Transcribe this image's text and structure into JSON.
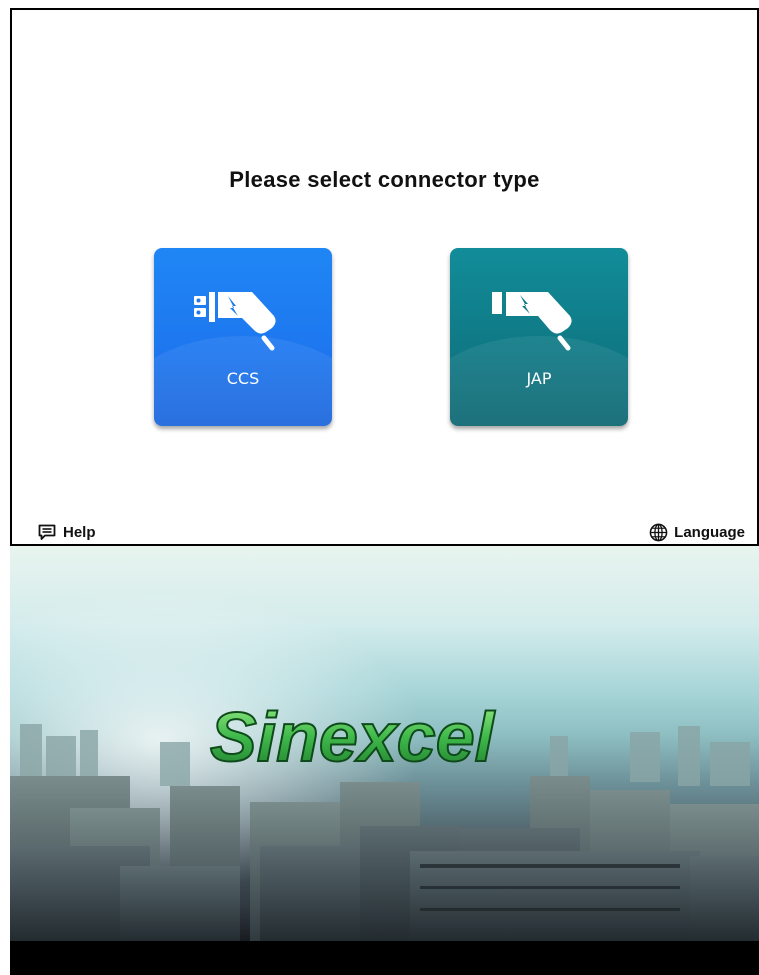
{
  "screen": {
    "title": "Please select connector type",
    "connectors": [
      {
        "label": "CCS",
        "color": "#1e78f0"
      },
      {
        "label": "JAP",
        "color": "#0f7a86"
      }
    ],
    "footer": {
      "help_label": "Help",
      "help_icon": "chat-bubble-icon",
      "language_label": "Language",
      "language_icon": "globe-icon"
    }
  },
  "banner": {
    "logo_text": "Sinexcel",
    "scene": "city-skyline"
  }
}
